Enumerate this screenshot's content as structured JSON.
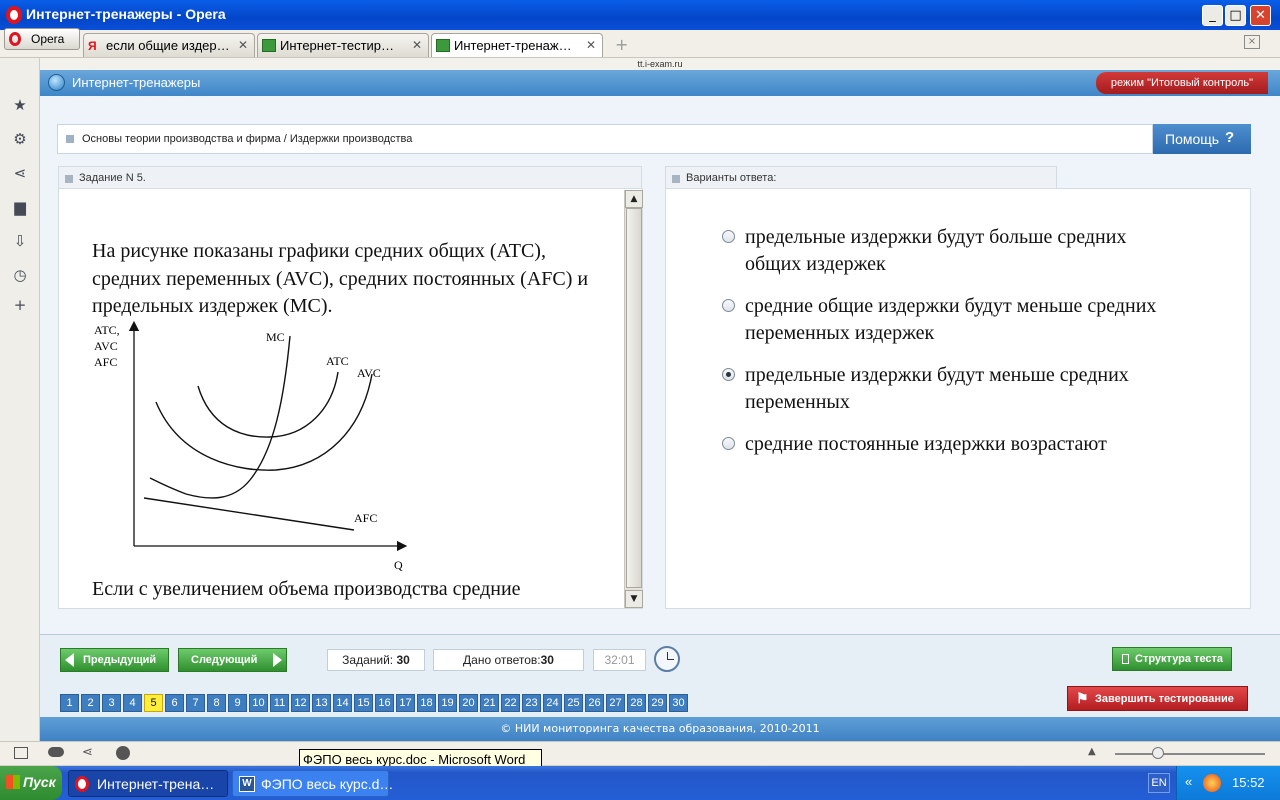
{
  "window": {
    "title": "Интернет-тренажеры - Opera"
  },
  "browser": {
    "menu_label": "Opera",
    "tabs": [
      {
        "label": "если общие издер…",
        "favicon": "yandex-icon"
      },
      {
        "label": "Интернет-тестир…",
        "favicon": "exam-icon"
      },
      {
        "label": "Интернет-тренаж…",
        "favicon": "exam-icon",
        "active": true
      }
    ],
    "url": "tt.i-exam.ru"
  },
  "site": {
    "title": "Интернет-тренажеры",
    "mode": "режим \"Итоговый контроль\"",
    "breadcrumb": "Основы теории производства и фирма / Издержки производства",
    "help_label": "Помощь",
    "help_icon": "?"
  },
  "task": {
    "header": "Задание N 5.",
    "text": "На рисунке показаны графики средних общих (ATC), средних переменных (AVC), средних постоянных (AFC) и предельных издержек (MC).",
    "text_cont": "Если с увеличением объема производства средние",
    "graph": {
      "y_axis_label": [
        "ATC,",
        "AVC",
        "AFC"
      ],
      "x_axis_label": "Q",
      "curves": [
        "MC",
        "ATC",
        "AVC",
        "AFC"
      ]
    }
  },
  "answers": {
    "header": "Варианты ответа:",
    "options": [
      {
        "text": "предельные издержки будут больше средних общих издержек",
        "selected": false
      },
      {
        "text": "средние общие издержки будут меньше средних переменных издержек",
        "selected": false
      },
      {
        "text": "предельные издержки будут меньше средних переменных",
        "selected": true
      },
      {
        "text": "средние постоянные издержки возрастают",
        "selected": false
      }
    ]
  },
  "nav": {
    "prev": "Предыдущий",
    "next": "Следующий",
    "tasks_label": "Заданий:",
    "tasks_count": "30",
    "answered_label": "Дано ответов:",
    "answered_count": "30",
    "timer": "32:01",
    "structure": "Структура теста",
    "finish": "Завершить тестирование",
    "current": 5,
    "question_numbers": [
      "1",
      "2",
      "3",
      "4",
      "5",
      "6",
      "7",
      "8",
      "9",
      "10",
      "11",
      "12",
      "13",
      "14",
      "15",
      "16",
      "17",
      "18",
      "19",
      "20",
      "21",
      "22",
      "23",
      "24",
      "25",
      "26",
      "27",
      "28",
      "29",
      "30"
    ]
  },
  "footer": "© НИИ мониторинга качества образования, 2010-2011",
  "tooltip": "ФЭПО весь курс.doc - Microsoft Word",
  "taskbar": {
    "start": "Пуск",
    "tasks": [
      "Интернет-трена…",
      "ФЭПО весь курс.d…"
    ],
    "lang": "EN",
    "clock": "15:52"
  }
}
